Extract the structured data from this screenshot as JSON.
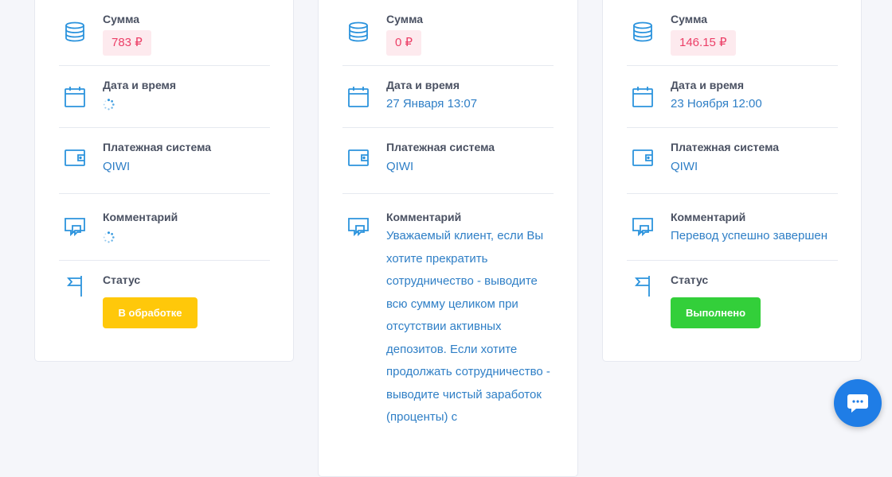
{
  "labels": {
    "amount": "Сумма",
    "datetime": "Дата и время",
    "payment_system": "Платежная система",
    "comment": "Комментарий",
    "status": "Статус"
  },
  "cards": [
    {
      "amount": "783 ₽",
      "datetime": "",
      "datetime_loading": true,
      "payment_system": "QIWI",
      "comment": "",
      "comment_loading": true,
      "status": "В обработке",
      "status_color": "#ffc80a"
    },
    {
      "amount": "0 ₽",
      "datetime": "27 Января 13:07",
      "payment_system": "QIWI",
      "comment": "Уважаемый клиент, если Вы хотите прекратить сотрудничество - выводите всю сумму целиком при отсутствии активных депозитов. Если хотите продолжать сотрудничество - выводите чистый заработок (проценты) с"
    },
    {
      "amount": "146.15 ₽",
      "datetime": "23 Ноября 12:00",
      "payment_system": "QIWI",
      "comment": "Перевод успешно завершен",
      "status": "Выполнено",
      "status_color": "#33cf3a"
    }
  ],
  "colors": {
    "accent": "#2b93dd",
    "value_text": "#2f7fc6",
    "amount_text": "#ec3f67",
    "amount_bg": "#fdeaee",
    "chat_widget": "#1f7de6"
  },
  "icons": {
    "amount": "coins-stack-icon",
    "datetime": "calendar-icon",
    "payment_system": "wallet-icon",
    "comment": "chat-bubbles-icon",
    "status": "flag-icon",
    "loading": "spinner-icon",
    "chat_widget": "chat-icon"
  }
}
